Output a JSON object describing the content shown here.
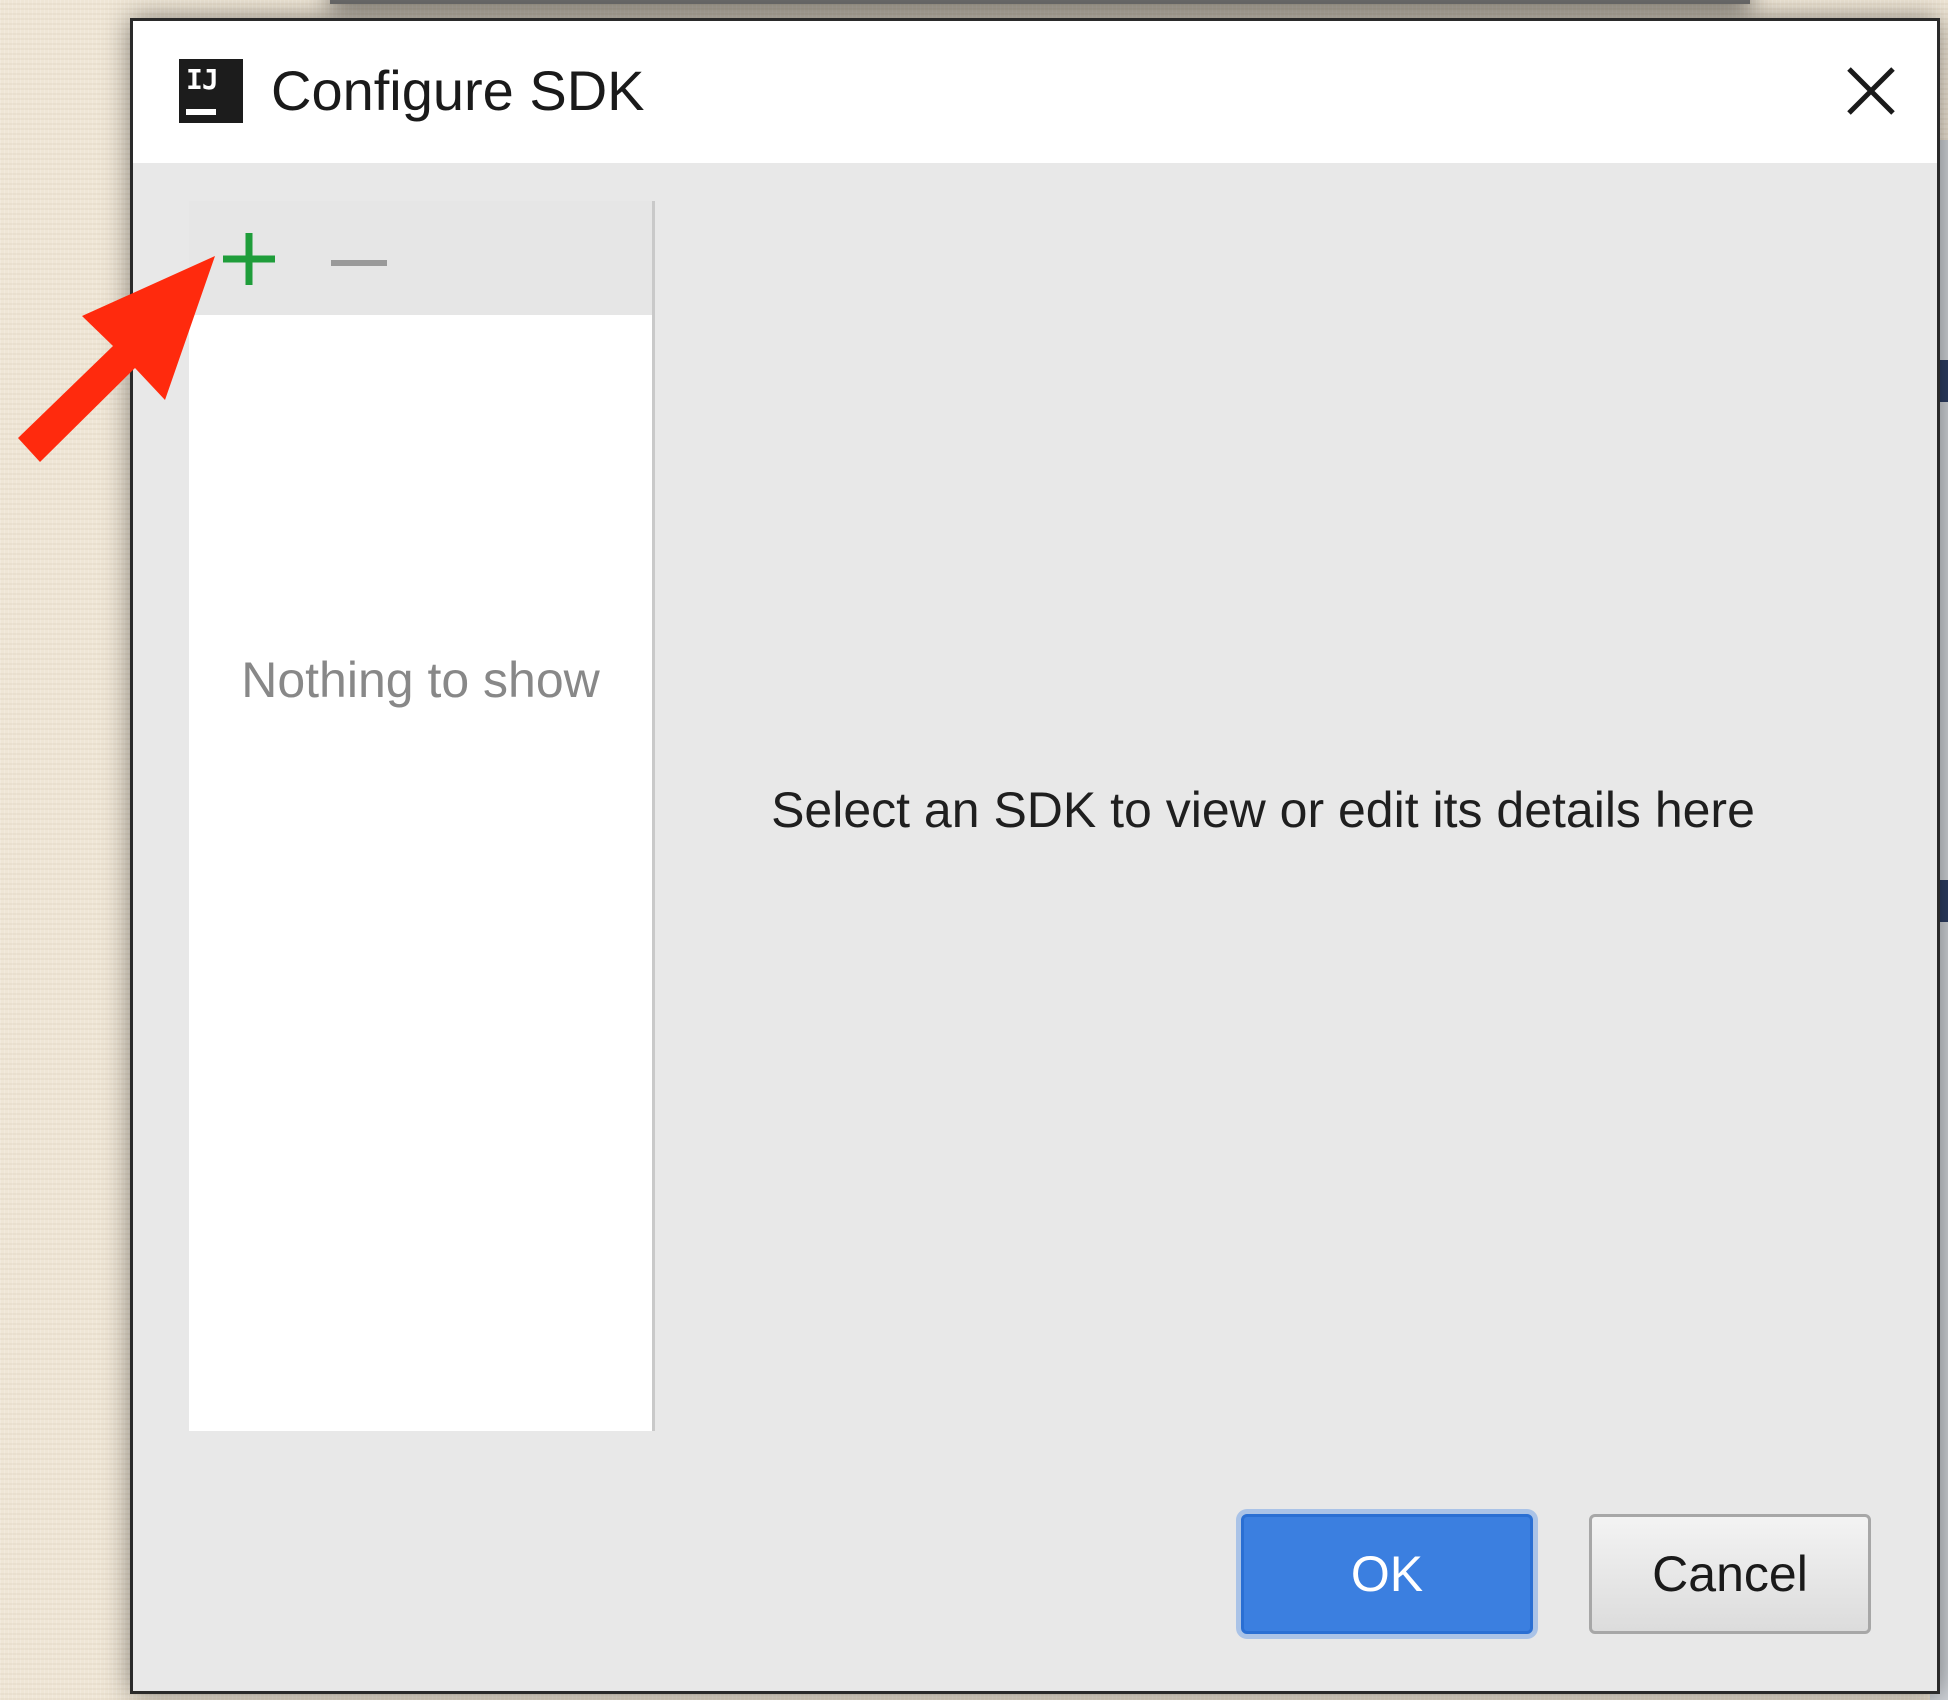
{
  "dialog": {
    "title": "Configure SDK",
    "app_icon_text": "IJ"
  },
  "sdk_list": {
    "empty_text": "Nothing to show"
  },
  "details": {
    "placeholder_text": "Select an SDK to view or edit its details here"
  },
  "buttons": {
    "ok": "OK",
    "cancel": "Cancel"
  },
  "colors": {
    "add_icon": "#1f9d3a",
    "remove_icon": "#9a9a9a",
    "ok_button": "#3b7fe0",
    "annotation_arrow": "#ff2a0d"
  },
  "icons": [
    "app-icon",
    "close-icon",
    "add-icon",
    "remove-icon",
    "annotation-arrow-icon"
  ]
}
